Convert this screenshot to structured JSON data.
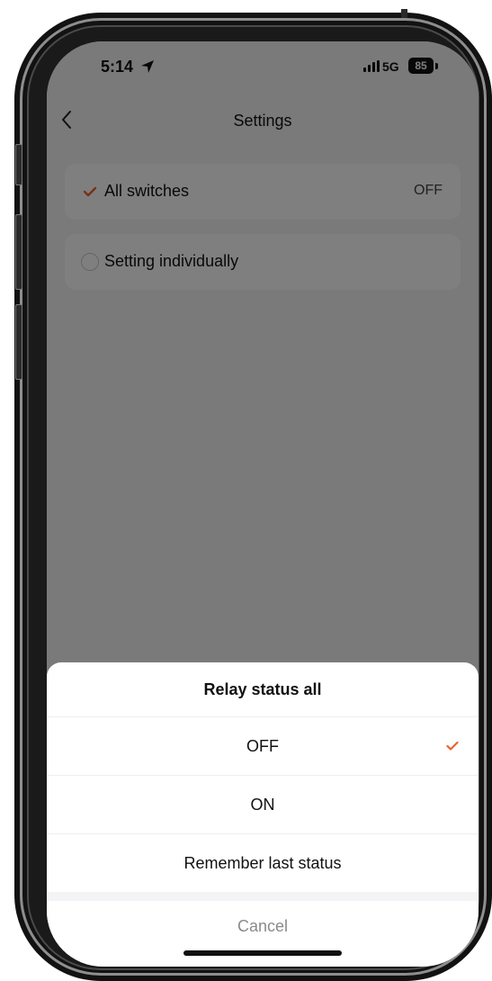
{
  "status_bar": {
    "time": "5:14",
    "network": "5G",
    "battery": "85"
  },
  "nav": {
    "title": "Settings"
  },
  "settings": {
    "items": [
      {
        "label": "All switches",
        "value": "OFF",
        "selected": true
      },
      {
        "label": "Setting individually",
        "selected": false
      }
    ]
  },
  "sheet": {
    "title": "Relay status all",
    "options": [
      {
        "label": "OFF",
        "selected": true
      },
      {
        "label": "ON",
        "selected": false
      },
      {
        "label": "Remember last status",
        "selected": false
      }
    ],
    "cancel_label": "Cancel"
  },
  "colors": {
    "accent": "#e8652a",
    "overlay": "#000000"
  }
}
